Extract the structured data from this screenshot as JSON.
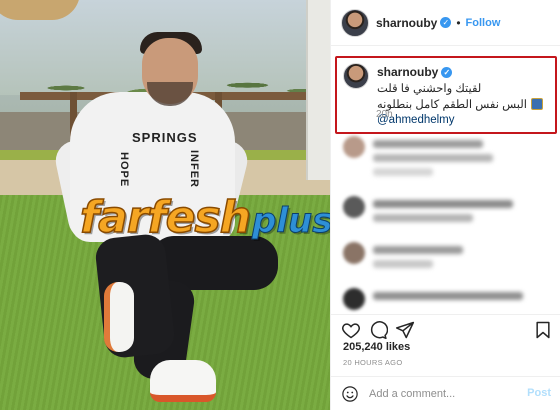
{
  "post": {
    "username": "sharnouby",
    "verified_mark": "✓",
    "separator": "•",
    "follow_label": "Follow",
    "caption_line1": "لقيتك واحشني فا قلت",
    "caption_line2": "البس نفس الطقم كامل بنطلونه",
    "mention": "@ahmedhelmy",
    "caption_time": "20h",
    "likes": "205,240 likes",
    "posted_ago": "20 HOURS AGO",
    "comment_placeholder": "Add a comment...",
    "post_label": "Post"
  },
  "photo": {
    "hoodie_text_1": "SPRINGS",
    "hoodie_text_2": "INFER",
    "hoodie_text_3": "HOPE"
  },
  "watermark": {
    "main": "farfesh",
    "suffix": "plus.com"
  },
  "colors": {
    "accent": "#3897f0",
    "highlight_border": "#c4161c",
    "watermark_orange": "#f5a623",
    "watermark_blue": "#2e8fd6"
  },
  "icons": [
    "heart-icon",
    "comment-icon",
    "share-icon",
    "bookmark-icon",
    "emoji-icon",
    "verified-icon"
  ]
}
